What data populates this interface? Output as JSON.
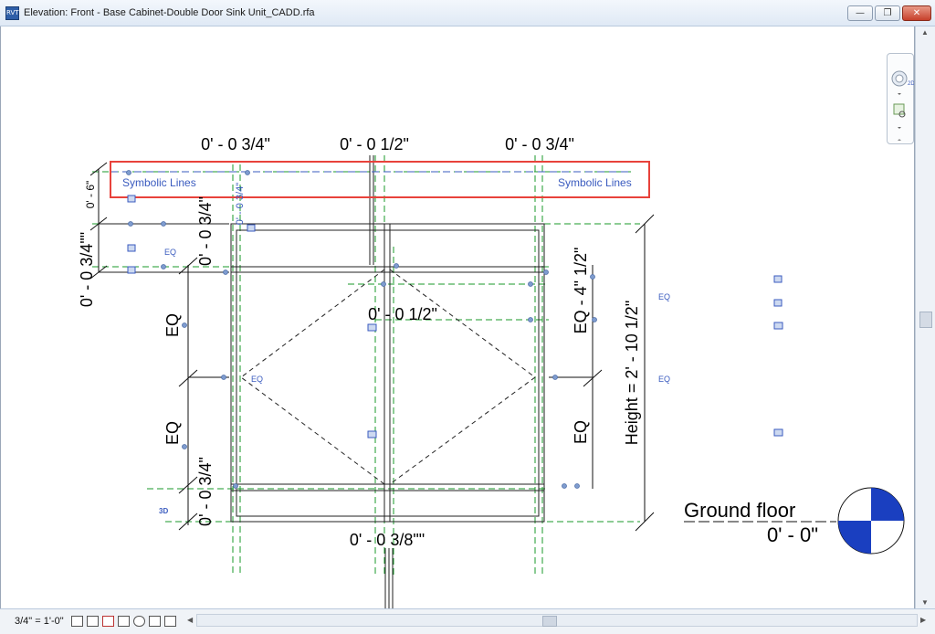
{
  "window": {
    "title": "Elevation: Front - Base Cabinet-Double Door Sink Unit_CADD.rfa",
    "app_icon_text": "RVT",
    "minimize": "—",
    "restore": "❐",
    "close": "✕"
  },
  "colors": {
    "selection_box": "#e8423b",
    "symbolic_label": "#3a5bbf",
    "ref_plane": "#1a9a2a",
    "grip": "#7f9ccf"
  },
  "dimensions": {
    "top_left": "0' - 0 3/4\"",
    "top_center": "0' - 0 1/2\"",
    "top_right": "0' - 0 3/4\"",
    "mid_center": "0' - 0 1/2\"",
    "bottom_center": "0' - 0 3/8\"\"",
    "left_small": "0' - 6\"",
    "left_large": "0' - 0 3/4\"\"",
    "left_vertical_top": "0' - 0 3/4\"",
    "left_vertical_bottom": "0' - 0 3/4\"",
    "eq": "EQ",
    "right_vertical_top": "EQ - 4\" 1/2\"",
    "height": "Height = 2' - 10 1/2\"",
    "blue_vertical": "0' - 0 3/4\""
  },
  "labels": {
    "symbolic_left": "Symbolic Lines",
    "symbolic_right": "Symbolic Lines",
    "eq_small": "EQ",
    "view_3d": "3D"
  },
  "level": {
    "name": "Ground floor",
    "elevation": "0' - 0\""
  },
  "navbar": {
    "wheel_label": "2D",
    "wheel_icon": "steering-wheel-icon",
    "zoom_icon": "zoom-region-icon"
  },
  "status": {
    "scale": "3/4\" = 1'-0\"",
    "icons": [
      "detail-level-icon",
      "visual-style-icon",
      "sun-path-icon",
      "shadows-icon",
      "rendering-icon",
      "crop-view-icon",
      "show-crop-icon",
      "temporary-hide-icon"
    ]
  }
}
